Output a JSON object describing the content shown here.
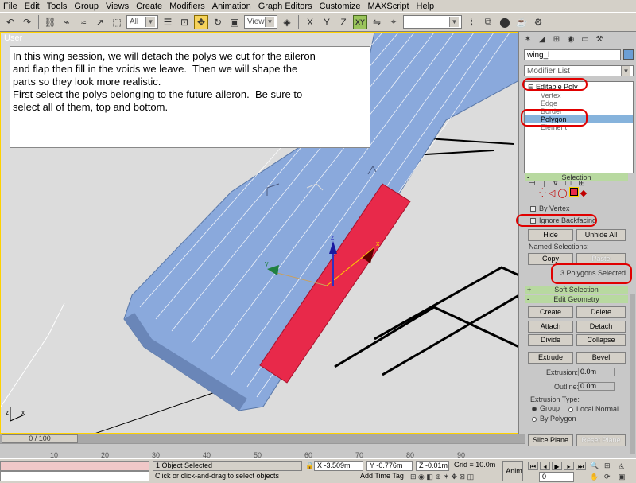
{
  "menu": [
    "File",
    "Edit",
    "Tools",
    "Group",
    "Views",
    "Create",
    "Modifiers",
    "Animation",
    "Graph Editors",
    "Customize",
    "MAXScript",
    "Help"
  ],
  "toolbar": {
    "selection_filter": "All",
    "reference_coord": "View",
    "axis_constraint": "XY"
  },
  "viewport": {
    "label": "User",
    "annotation": "In this wing session, we will detach the polys we cut for the aileron\nand flap then fill in the voids we leave.  Then we will shape the\nparts so they look more realistic.\nFirst select the polys belonging to the future aileron.  Be sure to\nselect all of them, top and bottom.",
    "gizmo_labels": {
      "x": "x",
      "y": "y",
      "z": "z"
    },
    "selected_face_color": "#e8294a",
    "mesh_color": "#8aa9dc"
  },
  "command_panel": {
    "object_name": "wing_l",
    "object_color": "#6b9ed4",
    "modifier_list": "Modifier List",
    "stack": {
      "modifier": "Editable Poly",
      "subobjects": [
        "Vertex",
        "Edge",
        "Border",
        "Polygon",
        "Element"
      ],
      "selected": "Polygon"
    },
    "selection": {
      "title": "Selection",
      "by_vertex": "By Vertex",
      "ignore_backfacing": "Ignore Backfacing",
      "hide": "Hide",
      "unhide_all": "Unhide All",
      "named_selections": "Named Selections:",
      "copy": "Copy",
      "paste": "Paste",
      "status": "3 Polygons Selected"
    },
    "soft_selection": {
      "title": "Soft Selection",
      "sign": "+"
    },
    "edit_geometry": {
      "title": "Edit Geometry",
      "sign": "-",
      "create": "Create",
      "delete": "Delete",
      "attach": "Attach",
      "detach": "Detach",
      "divide": "Divide",
      "collapse": "Collapse",
      "extrude": "Extrude",
      "bevel": "Bevel",
      "extrusion_label": "Extrusion:",
      "extrusion_value": "0.0m",
      "outline_label": "Outline:",
      "outline_value": "0.0m",
      "extrusion_type": "Extrusion Type:",
      "group": "Group",
      "local_normal": "Local Normal",
      "by_polygon": "By Polygon",
      "slice_plane": "Slice Plane",
      "reset_plane": "Reset Plane"
    }
  },
  "time_slider": {
    "frame": "0 / 100"
  },
  "track_ticks": [
    "10",
    "20",
    "30",
    "40",
    "50",
    "60",
    "70",
    "80",
    "90"
  ],
  "status": {
    "selected": "1 Object Selected",
    "prompt": "Click or click-and-drag to select objects",
    "x": "-3.509m",
    "y": "-0.776m",
    "z": "-0.01m",
    "grid": "Grid = 10.0m",
    "add_time_tag": "Add Time Tag",
    "anim": "Anim",
    "frame_field": "0"
  }
}
